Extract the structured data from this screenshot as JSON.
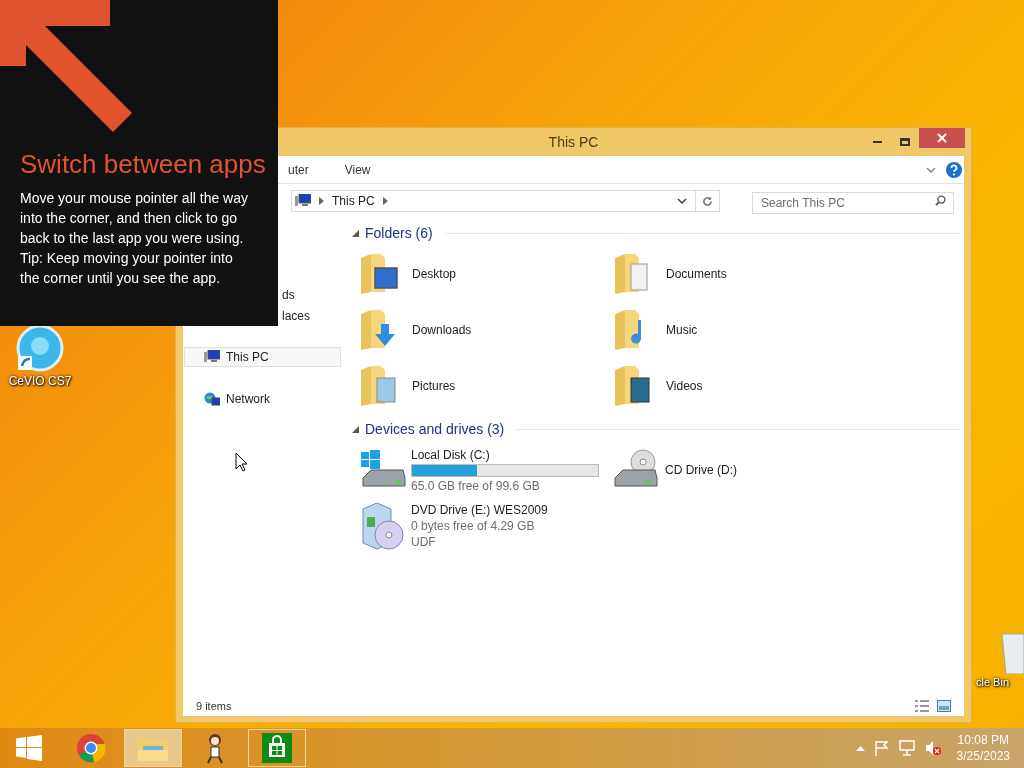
{
  "desktop_icons": [
    {
      "label": "CeVIO CS7",
      "kind": "app"
    },
    {
      "label": "cle Bin",
      "kind": "bin"
    }
  ],
  "tip": {
    "title": "Switch between apps",
    "body": "Move your mouse pointer all the way into the corner, and then click to go back to the last app you were using.",
    "hint": "Tip: Keep moving your pointer into the corner until you see the app."
  },
  "window": {
    "title": "This PC",
    "ribbon_tabs": [
      "uter",
      "View"
    ],
    "address": {
      "crumbs": [
        "This PC"
      ]
    },
    "search": {
      "placeholder": "Search This PC"
    },
    "nav_pane": [
      {
        "label": "ds",
        "selected": false,
        "kind": "partial"
      },
      {
        "label": "laces",
        "selected": false,
        "kind": "partial"
      },
      {
        "label": "This PC",
        "selected": true,
        "kind": "pc"
      },
      {
        "label": "Network",
        "selected": false,
        "kind": "network"
      }
    ],
    "sections": [
      {
        "title": "Folders (6)",
        "expanded": true,
        "items": [
          {
            "name": "Desktop",
            "kind": "desktop"
          },
          {
            "name": "Documents",
            "kind": "documents"
          },
          {
            "name": "Downloads",
            "kind": "downloads"
          },
          {
            "name": "Music",
            "kind": "music"
          },
          {
            "name": "Pictures",
            "kind": "pictures"
          },
          {
            "name": "Videos",
            "kind": "videos"
          }
        ]
      },
      {
        "title": "Devices and drives (3)",
        "expanded": true,
        "items": [
          {
            "name": "Local Disk (C:)",
            "kind": "disk",
            "level": 0.35,
            "details": [
              "65.0 GB free of 99.6 GB"
            ]
          },
          {
            "name": "CD Drive (D:)",
            "kind": "cd"
          },
          {
            "name": "DVD Drive (E:) WES2009",
            "kind": "dvd",
            "details": [
              "0 bytes free of 4.29 GB",
              "UDF"
            ]
          }
        ]
      }
    ],
    "status_bar": {
      "text": "9 items"
    }
  },
  "taskbar": {
    "apps": [
      {
        "kind": "start",
        "active": false,
        "open": false
      },
      {
        "kind": "chrome",
        "active": false,
        "open": false
      },
      {
        "kind": "explorer",
        "active": true,
        "open": true
      },
      {
        "kind": "character",
        "active": false,
        "open": false
      },
      {
        "kind": "store",
        "active": false,
        "open": true
      }
    ],
    "clock": {
      "time": "10:08 PM",
      "date": "3/25/2023"
    }
  }
}
